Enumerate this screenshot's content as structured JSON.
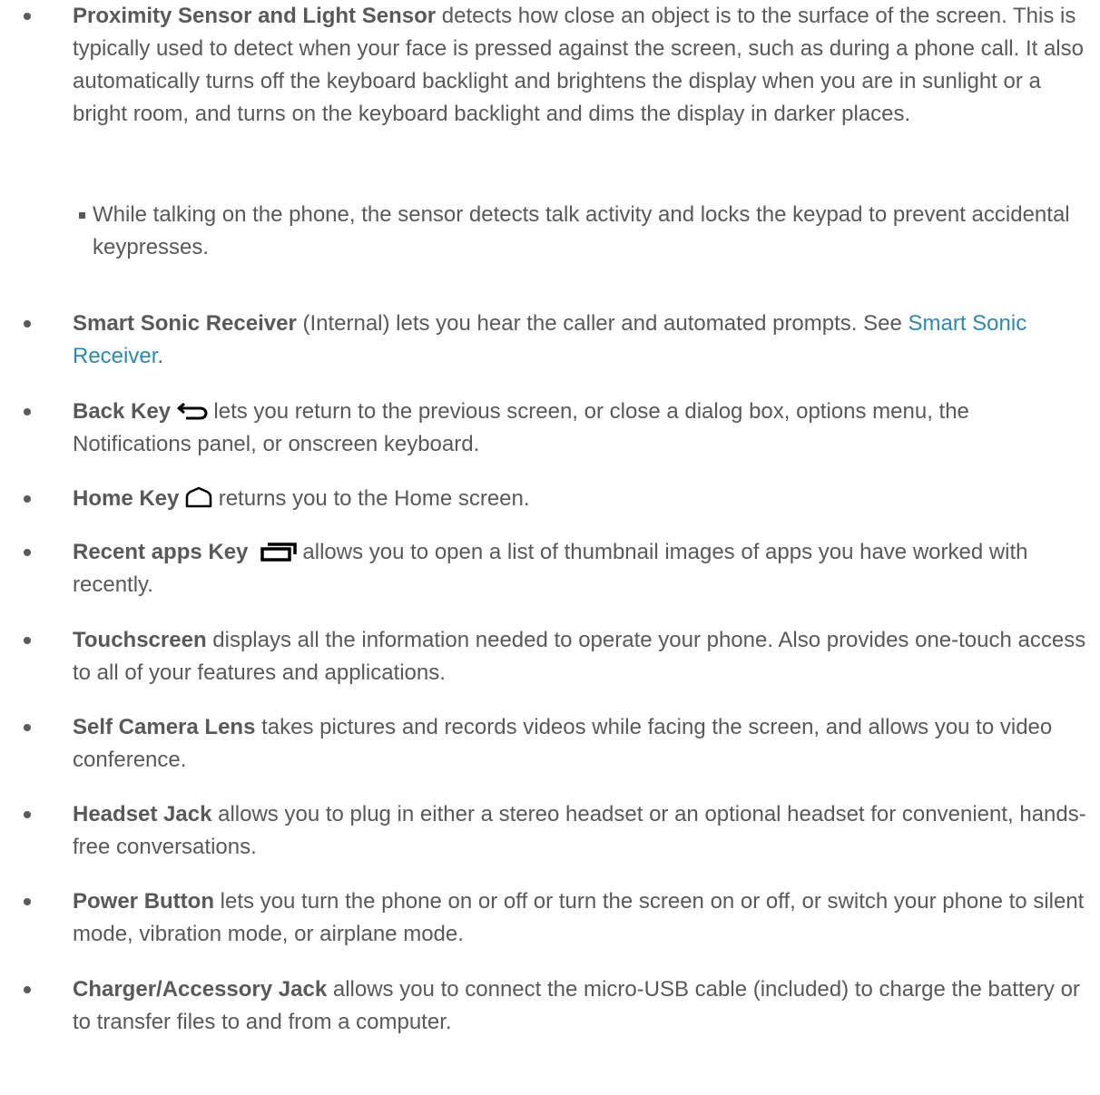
{
  "items": [
    {
      "term": "Proximity Sensor and Light Sensor",
      "desc": " detects how close an object is to the surface of the screen. This is typically used to detect when your face is pressed against the screen, such as during a phone call. It also automatically turns off the keyboard backlight and brightens the display when you are in sunlight or a bright room, and turns on the keyboard backlight and dims the display in darker places."
    },
    {
      "sub": "While talking on the phone, the sensor detects talk activity and locks the keypad to prevent accidental keypresses."
    },
    {
      "term": "Smart Sonic Receiver",
      "desc": " (Internal) lets you hear the caller and automated prompts. See ",
      "link": "Smart Sonic Receiver",
      "after": "."
    },
    {
      "term": "Back Key",
      "icon": "back-arrow-icon",
      "desc": " lets you return to the previous screen, or close a dialog box, options menu, the Notifications panel, or onscreen keyboard."
    },
    {
      "term": "Home Key",
      "icon": "home-icon",
      "desc": " returns you to the Home screen."
    },
    {
      "term": "Recent apps Key",
      "icon": "recent-apps-icon",
      "desc": " allows you to open a list of thumbnail images of apps you have worked with recently."
    },
    {
      "term": "Touchscreen",
      "desc": " displays all the information needed to operate your phone. Also provides one-touch access to all of your features and applications."
    },
    {
      "term": "Self Camera Lens",
      "desc": " takes pictures and records videos while facing the screen, and allows you to video conference."
    },
    {
      "term": "Headset Jack",
      "desc": " allows you to plug in either a stereo headset or an optional headset for convenient, hands-free conversations."
    },
    {
      "term": "Power Button",
      "desc": " lets you turn the phone on or off or turn the screen on or off, or switch your phone to silent mode, vibration mode, or airplane mode."
    },
    {
      "term": "Charger/Accessory Jack",
      "desc": " allows you to connect the micro-USB cable (included) to charge the battery or to transfer files to and from a computer."
    }
  ],
  "colors": {
    "text": "#595959",
    "link": "#2a8ab4"
  }
}
